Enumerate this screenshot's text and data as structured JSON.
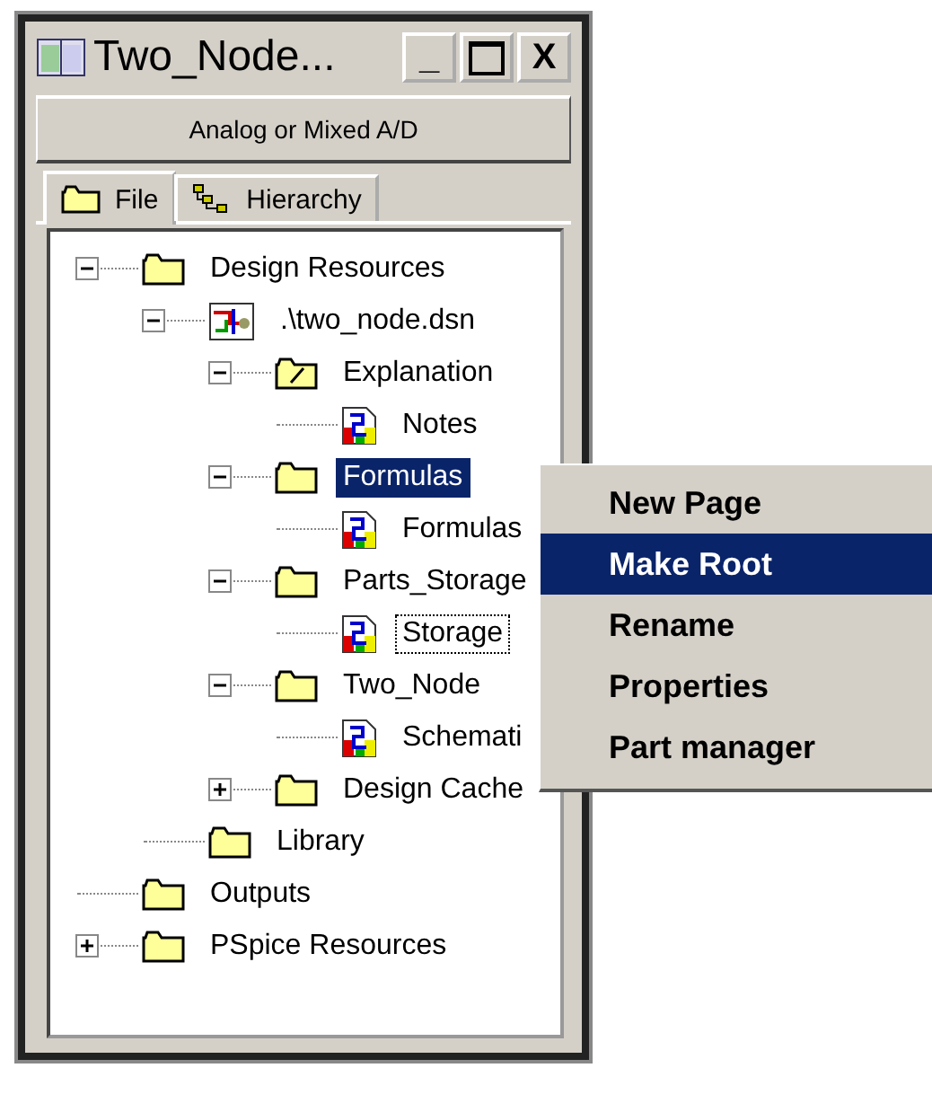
{
  "window": {
    "title": "Two_Node..."
  },
  "window_controls": [
    {
      "kind": "minimize",
      "label": "_"
    },
    {
      "kind": "maximize"
    },
    {
      "kind": "close",
      "label": "X"
    }
  ],
  "mode_bar": "Analog or Mixed A/D",
  "tabs": [
    {
      "label": "File",
      "kind": "folder",
      "selected": true
    },
    {
      "label": "Hierarchy",
      "kind": "hierarchy",
      "selected": false
    }
  ],
  "tree": [
    {
      "label": "Design Resources",
      "kind": "folder",
      "expanded": true,
      "selected": false,
      "focused": false,
      "children": [
        {
          "label": ".\\two_node.dsn",
          "kind": "design",
          "expanded": true,
          "selected": false,
          "focused": false,
          "children": [
            {
              "label": "Explanation",
              "kind": "note-folder",
              "expanded": true,
              "selected": false,
              "focused": false,
              "children": [
                {
                  "label": "Notes",
                  "kind": "page",
                  "selected": false,
                  "focused": false
                }
              ]
            },
            {
              "label": "Formulas",
              "kind": "folder",
              "expanded": true,
              "selected": true,
              "focused": false,
              "children": [
                {
                  "label": "Formulas",
                  "kind": "page",
                  "selected": false,
                  "focused": false
                }
              ]
            },
            {
              "label": "Parts_Storage",
              "kind": "folder",
              "expanded": true,
              "selected": false,
              "focused": false,
              "children": [
                {
                  "label": "Storage",
                  "kind": "page",
                  "selected": false,
                  "focused": true
                }
              ]
            },
            {
              "label": "Two_Node",
              "kind": "folder",
              "expanded": true,
              "selected": false,
              "focused": false,
              "children": [
                {
                  "label": "Schemati",
                  "kind": "page",
                  "selected": false,
                  "focused": false
                }
              ]
            },
            {
              "label": "Design Cache",
              "kind": "folder",
              "expanded": false,
              "selected": false,
              "focused": false
            }
          ]
        },
        {
          "label": "Library",
          "kind": "folder",
          "selected": false,
          "focused": false
        }
      ]
    },
    {
      "label": "Outputs",
      "kind": "folder",
      "selected": false,
      "focused": false
    },
    {
      "label": "PSpice Resources",
      "kind": "folder",
      "expanded": false,
      "selected": false,
      "focused": false
    }
  ],
  "context_menu": [
    {
      "label": "New Page",
      "selected": false
    },
    {
      "label": "Make Root",
      "selected": true
    },
    {
      "label": "Rename",
      "selected": false
    },
    {
      "label": "Properties",
      "selected": false
    },
    {
      "label": "Part manager",
      "selected": false
    }
  ]
}
